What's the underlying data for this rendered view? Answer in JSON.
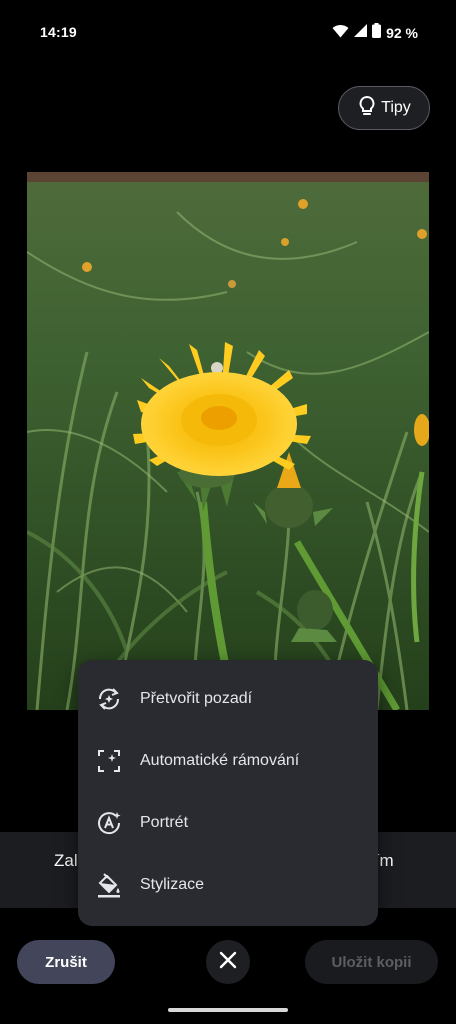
{
  "status_bar": {
    "time": "14:19",
    "battery": "92 %",
    "icons": [
      "wifi-icon",
      "signal-icon",
      "battery-icon"
    ]
  },
  "tips": {
    "label": "Tipy",
    "icon": "lightbulb-icon"
  },
  "photo": {
    "subject": "dandelion-photo"
  },
  "background_options": {
    "left_text": "Zal",
    "right_text": "tím"
  },
  "menu": {
    "items": [
      {
        "label": "Přetvořit pozadí",
        "icon": "reimagine-icon"
      },
      {
        "label": "Automatické rámování",
        "icon": "auto-frame-icon"
      },
      {
        "label": "Portrét",
        "icon": "portrait-icon"
      },
      {
        "label": "Stylizace",
        "icon": "paint-bucket-icon"
      }
    ]
  },
  "toolbar": {
    "cancel_label": "Zrušit",
    "close_icon": "close-icon",
    "save_label": "Uložit kopii"
  },
  "colors": {
    "menu_bg": "#2a2b30",
    "cancel_bg": "#43455a",
    "save_disabled_text": "#5d5e62"
  }
}
